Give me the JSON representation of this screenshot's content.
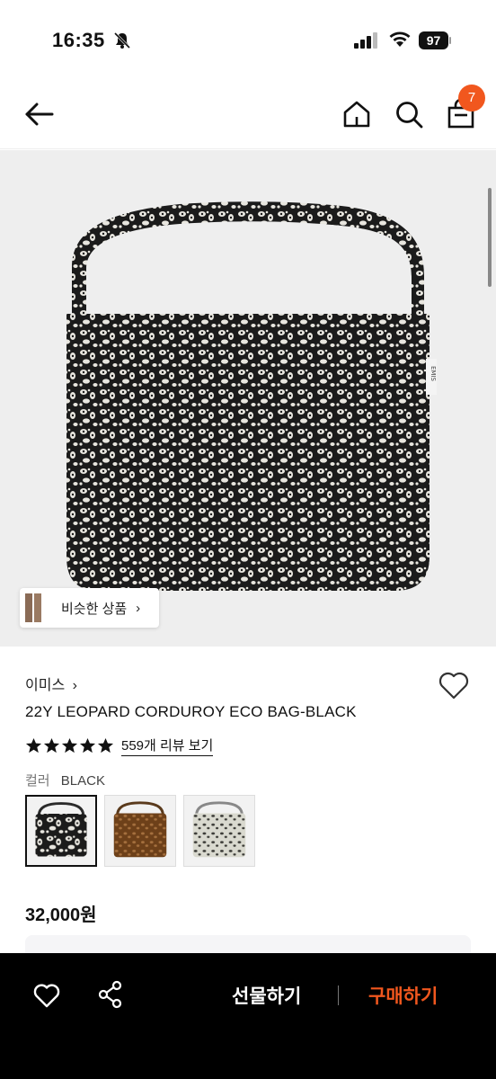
{
  "status_bar": {
    "time": "16:35",
    "battery": "97"
  },
  "header": {
    "cart_count": "7",
    "accent_color": "#f1571e"
  },
  "hero": {
    "similar_label": "비슷한 상품",
    "similar_chevron": "›",
    "image_icon": "leopard-eco-bag-image"
  },
  "product": {
    "brand": "이미스",
    "brand_chevron": "›",
    "name": "22Y LEOPARD CORDUROY ECO BAG-BLACK",
    "rating_stars": 5,
    "reviews_link": "559개 리뷰 보기",
    "color_label": "컬러",
    "color_value": "BLACK",
    "swatches": [
      {
        "name": "black",
        "color": "#2a2a2a"
      },
      {
        "name": "brown",
        "color": "#7a4a22"
      },
      {
        "name": "ivory",
        "color": "#dcdcd2"
      }
    ],
    "price": "32,000원"
  },
  "bottom_bar": {
    "gift_label": "선물하기",
    "buy_label": "구매하기"
  }
}
